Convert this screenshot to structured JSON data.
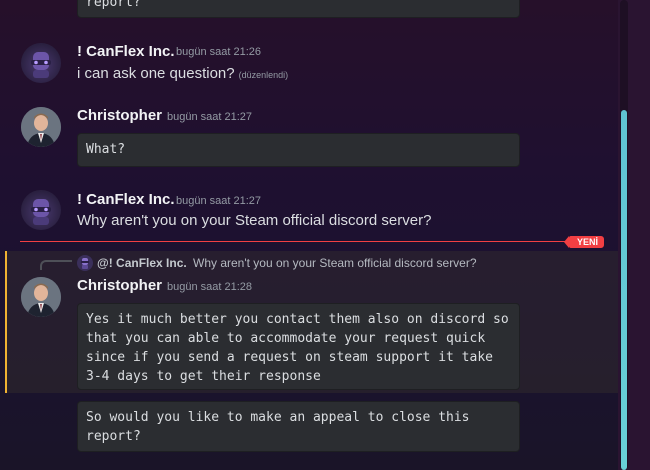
{
  "messages": [
    {
      "code": "report?"
    },
    {
      "author": "! CanFlex Inc.",
      "time": "bugün saat 21:26",
      "text": "i can ask one question?",
      "edited": "(düzenlendi)"
    },
    {
      "author": "Christopher",
      "time": "bugün saat 21:27",
      "code": "What?"
    },
    {
      "author": "! CanFlex Inc.",
      "time": "bugün saat 21:27",
      "text": "Why aren't you on your Steam official discord server?"
    },
    {
      "reply_author": "@! CanFlex Inc.",
      "reply_text": "Why aren't you on your Steam official discord server?",
      "author": "Christopher",
      "time": "bugün saat 21:28",
      "code": "Yes it much better you contact them also on discord so that you can able to accommodate your request quick since if you send a request on steam support it take 3-4 days to get their response"
    },
    {
      "code": "So would you like to make an appeal to close this report?"
    }
  ],
  "new_divider": "YENİ",
  "colors": {
    "accent_new": "#f23f43",
    "mention": "#f0b232",
    "scroll_thumb": "#5fc3d3"
  },
  "icons": {
    "canflex_avatar": "purple-masked-robot",
    "christopher_avatar": "man-in-suit-photo"
  }
}
